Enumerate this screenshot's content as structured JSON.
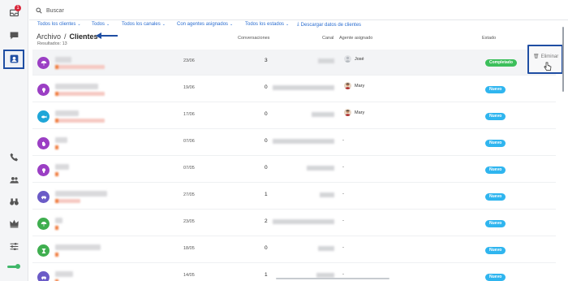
{
  "search": {
    "placeholder": "Buscar"
  },
  "filters": [
    "Todos los clientes",
    "Todos",
    "Todos los canales",
    "Con agentes asignados",
    "Todos los estados"
  ],
  "download_label": "Descargar datos de clientes",
  "breadcrumb": {
    "parent": "Archivo",
    "separator": "/",
    "current": "Clientes"
  },
  "results_label": "Resultados: 13",
  "columns": {
    "conversations": "Conversaciones",
    "channel": "Canal",
    "agent": "Agente asignado",
    "status": "Estado"
  },
  "delete_label": "Eliminar",
  "sidebar_badge": "1",
  "colors": {
    "accent": "#2a6dd0",
    "new": "#2fb5ef",
    "completed": "#3cbf5b",
    "highlight": "#1f4ea3"
  },
  "rows": [
    {
      "date": "23/06",
      "conversations": "3",
      "agent": "José",
      "status": "Completado",
      "avatar_color": "#9b3fc4",
      "avatar_icon": "umbrella-icon"
    },
    {
      "date": "19/06",
      "conversations": "0",
      "agent": "Mary",
      "status": "Nuevo",
      "avatar_color": "#9b3fc4",
      "avatar_icon": "lightbulb-icon"
    },
    {
      "date": "17/06",
      "conversations": "0",
      "agent": "Mary",
      "status": "Nuevo",
      "avatar_color": "#1fa6d8",
      "avatar_icon": "fish-icon"
    },
    {
      "date": "07/06",
      "conversations": "0",
      "agent": "-",
      "status": "Nuevo",
      "avatar_color": "#9b3fc4",
      "avatar_icon": "hand-icon"
    },
    {
      "date": "07/05",
      "conversations": "0",
      "agent": "-",
      "status": "Nuevo",
      "avatar_color": "#9b3fc4",
      "avatar_icon": "lightbulb-icon"
    },
    {
      "date": "27/05",
      "conversations": "1",
      "agent": "-",
      "status": "Nuevo",
      "avatar_color": "#6b5bc7",
      "avatar_icon": "car-icon"
    },
    {
      "date": "23/05",
      "conversations": "2",
      "agent": "-",
      "status": "Nuevo",
      "avatar_color": "#3fae4f",
      "avatar_icon": "umbrella-icon"
    },
    {
      "date": "18/05",
      "conversations": "0",
      "agent": "-",
      "status": "Nuevo",
      "avatar_color": "#3fae4f",
      "avatar_icon": "hourglass-icon"
    },
    {
      "date": "14/05",
      "conversations": "1",
      "agent": "-",
      "status": "Nuevo",
      "avatar_color": "#6b5bc7",
      "avatar_icon": "car-icon"
    }
  ]
}
